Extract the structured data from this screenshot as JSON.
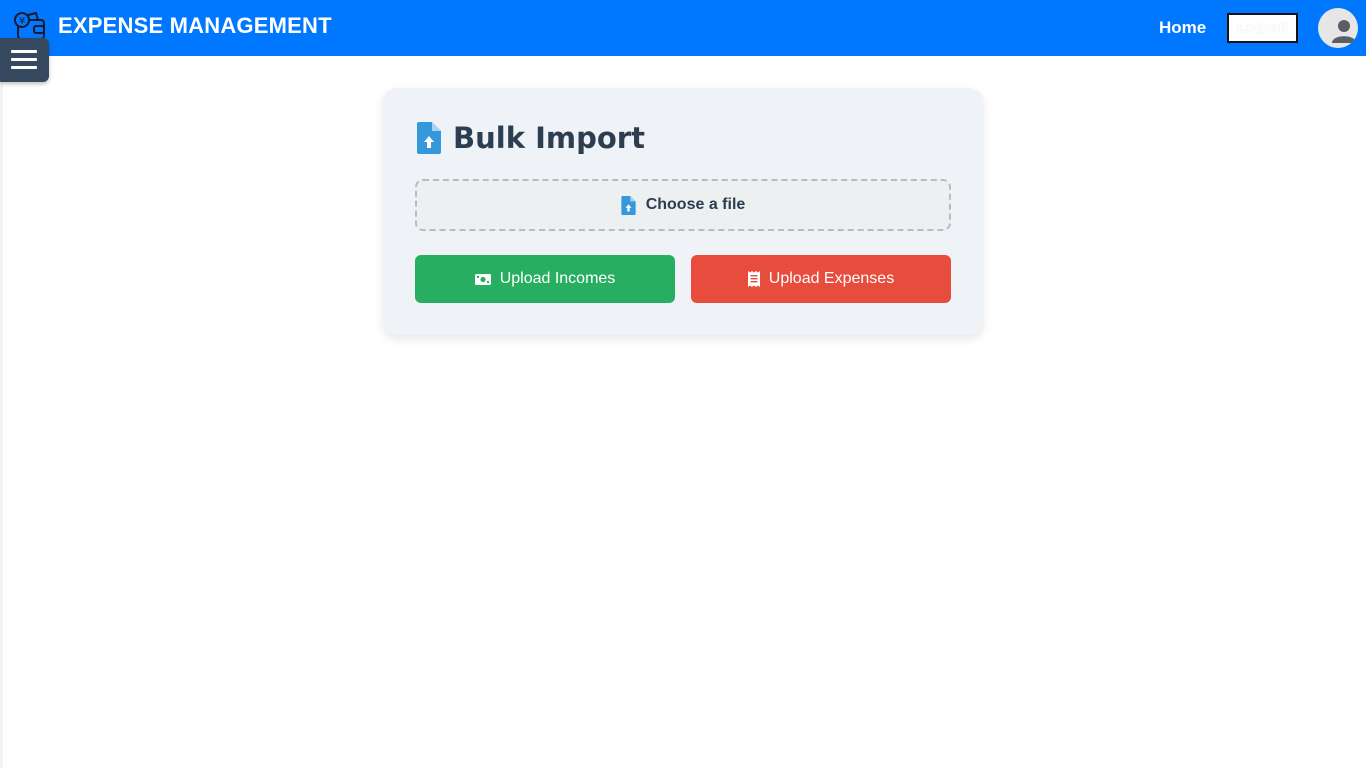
{
  "header": {
    "title": "EXPENSE MANAGEMENT",
    "nav_home": "Home",
    "logout_label": "Logout",
    "brand_icon": "wallet-money-icon",
    "avatar_icon": "user-avatar-icon",
    "background_color": "#0077ff"
  },
  "sidebar_toggle": {
    "icon": "hamburger-menu-icon",
    "color": "#34495e"
  },
  "card": {
    "title": "Bulk Import",
    "title_icon": "file-upload-icon",
    "file_input": {
      "label": "Choose a file",
      "icon": "file-upload-icon"
    },
    "buttons": {
      "upload_incomes": {
        "label": "Upload Incomes",
        "icon": "money-bill-icon",
        "color": "#27ae60"
      },
      "upload_expenses": {
        "label": "Upload Expenses",
        "icon": "receipt-icon",
        "color": "#e74c3c"
      }
    },
    "accent_color": "#3498db"
  }
}
